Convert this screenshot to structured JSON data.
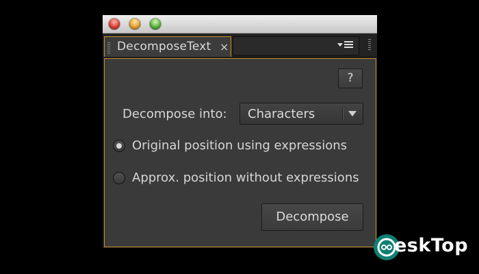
{
  "panel": {
    "tab_title": "DecomposeText",
    "tab_close_glyph": "×",
    "help_label": "?",
    "decompose_into_label": "Decompose into:",
    "decompose_into_value": "Characters",
    "radio_options": [
      {
        "label": "Original position using expressions",
        "selected": true
      },
      {
        "label": "Approx. position without expressions",
        "selected": false
      }
    ],
    "decompose_button_label": "Decompose",
    "accent_color": "#c8922a"
  },
  "watermark": {
    "text": "esk",
    "text2": "Top"
  }
}
